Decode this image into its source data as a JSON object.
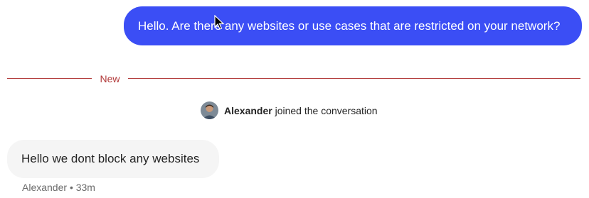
{
  "outgoing_message": {
    "text": "Hello. Are there any websites or use cases that are restricted on your network?"
  },
  "divider": {
    "label": "New"
  },
  "system_event": {
    "name": "Alexander",
    "text": "joined the conversation",
    "avatar_icon": "user-avatar-icon"
  },
  "incoming_message": {
    "text": "Hello we dont block any websites",
    "sender": "Alexander",
    "separator": "•",
    "time": "33m"
  },
  "colors": {
    "outgoing_bubble": "#3b4ef5",
    "incoming_bubble": "#f5f5f5",
    "divider": "#b23a3a"
  },
  "icons": {
    "cursor": "mouse-pointer-icon"
  }
}
